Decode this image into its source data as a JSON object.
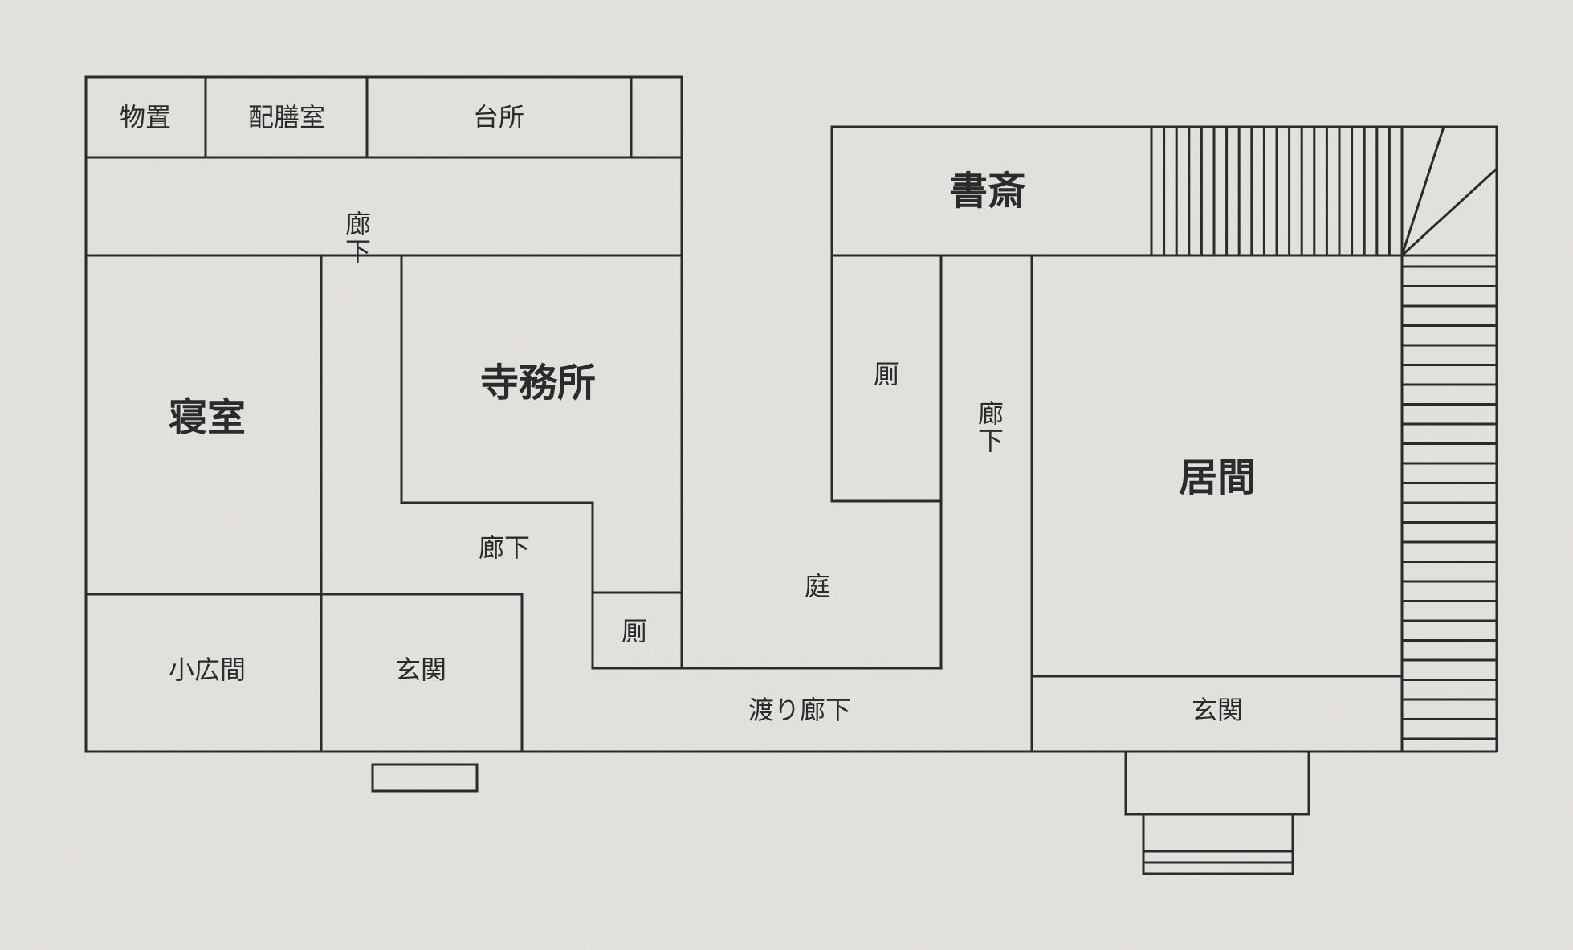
{
  "rooms": {
    "storage": "物置",
    "pantry": "配膳室",
    "kitchen": "台所",
    "hallway_top": "廊下",
    "bedroom": "寝室",
    "temple_office": "寺務所",
    "hallway_middle": "廊下",
    "toilet_small": "厠",
    "small_hall": "小広間",
    "entrance_left": "玄関",
    "study": "書斎",
    "toilet_right": "厠",
    "hallway_right": "廊下",
    "garden": "庭",
    "living_room": "居間",
    "corridor_connecting": "渡り廊下",
    "entrance_right": "玄関"
  },
  "colors": {
    "paper": "#e7e5e1",
    "ink": "#2b2b2b"
  }
}
